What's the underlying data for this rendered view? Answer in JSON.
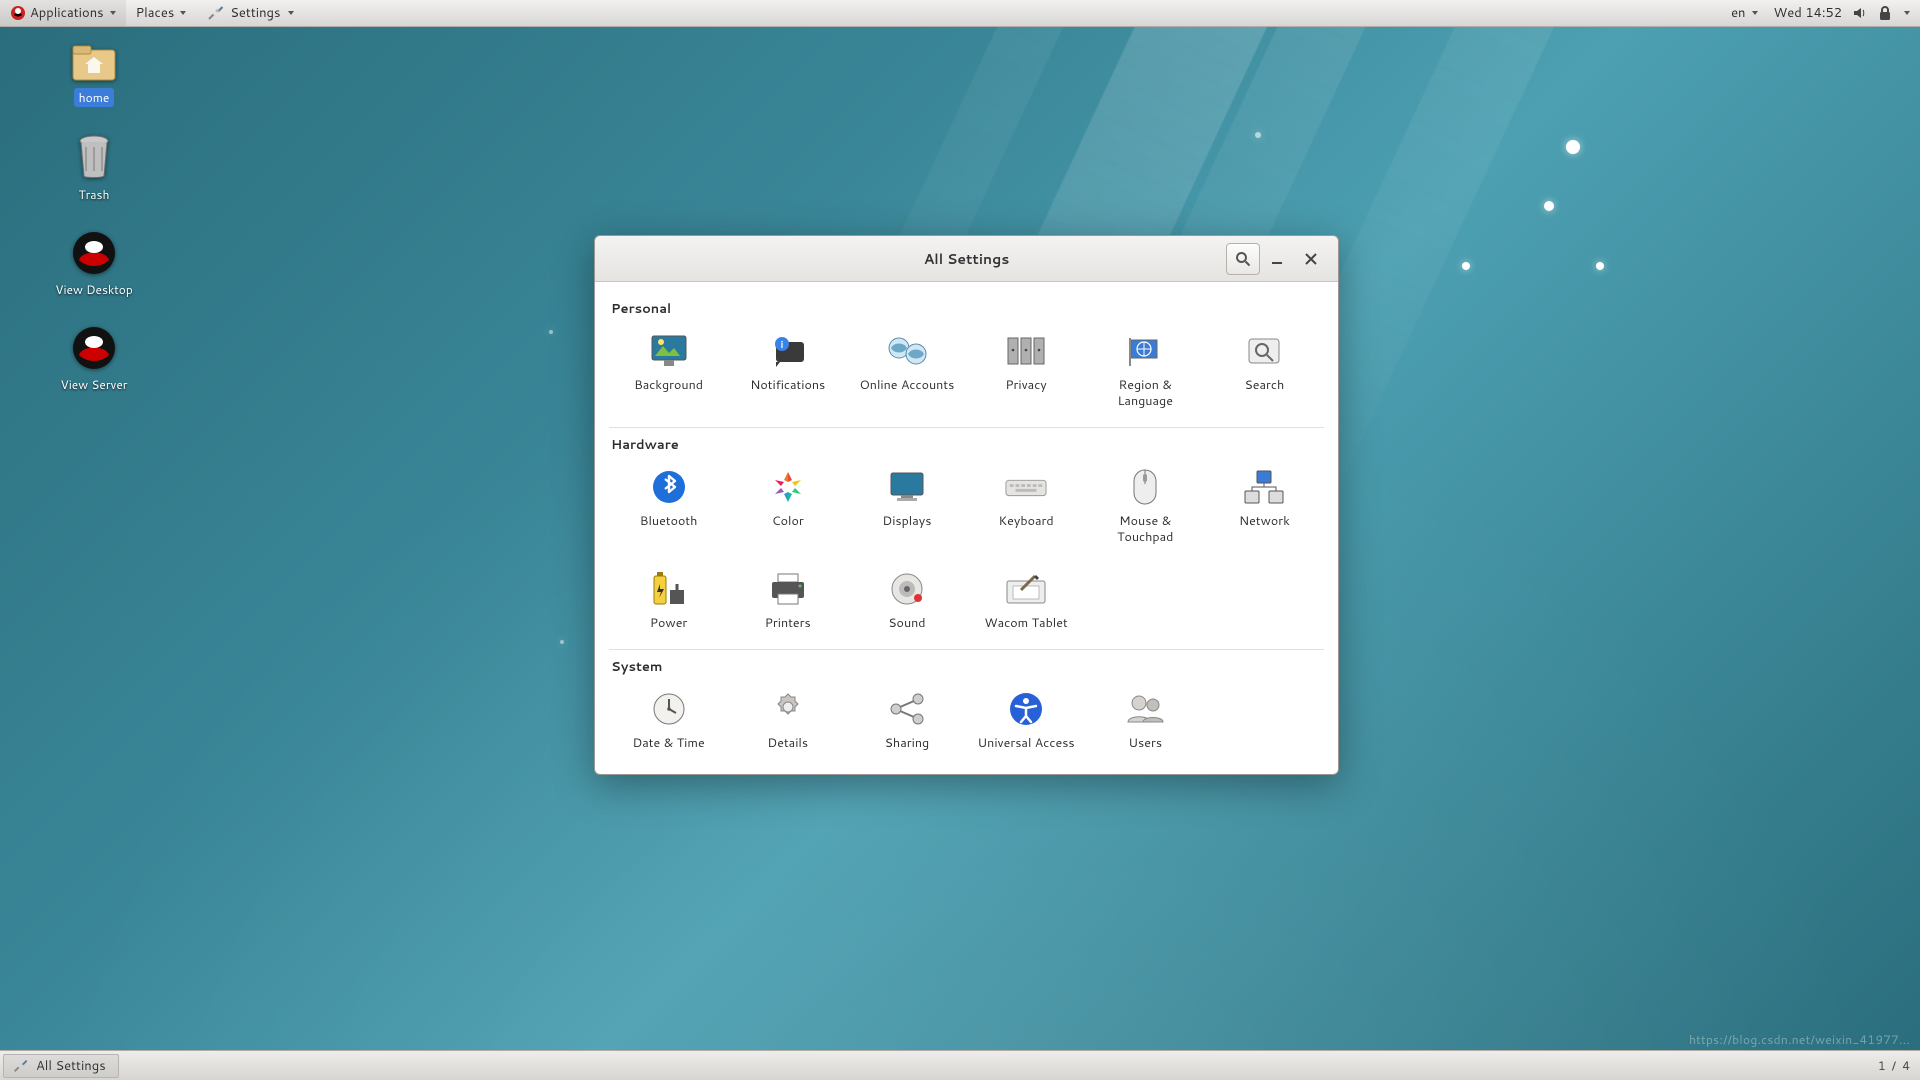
{
  "panel": {
    "applications": "Applications",
    "places": "Places",
    "active_app": "Settings",
    "lang": "en",
    "clock": "Wed 14:52"
  },
  "desktop_icons": {
    "home": "home",
    "trash": "Trash",
    "view_desktop": "View Desktop",
    "view_server": "View Server"
  },
  "window": {
    "title": "All Settings",
    "sections": {
      "personal": {
        "title": "Personal",
        "items": {
          "background": "Background",
          "notifications": "Notifications",
          "online_accounts": "Online Accounts",
          "privacy": "Privacy",
          "region_language": "Region & Language",
          "search": "Search"
        }
      },
      "hardware": {
        "title": "Hardware",
        "items": {
          "bluetooth": "Bluetooth",
          "color": "Color",
          "displays": "Displays",
          "keyboard": "Keyboard",
          "mouse_touchpad": "Mouse & Touchpad",
          "network": "Network",
          "power": "Power",
          "printers": "Printers",
          "sound": "Sound",
          "wacom": "Wacom Tablet"
        }
      },
      "system": {
        "title": "System",
        "items": {
          "date_time": "Date & Time",
          "details": "Details",
          "sharing": "Sharing",
          "universal_access": "Universal Access",
          "users": "Users"
        }
      }
    }
  },
  "taskbar": {
    "task1": "All Settings"
  },
  "pager": {
    "current": "1",
    "sep": " / ",
    "total": "4"
  },
  "watermark": "https://blog.csdn.net/weixin_41977..."
}
